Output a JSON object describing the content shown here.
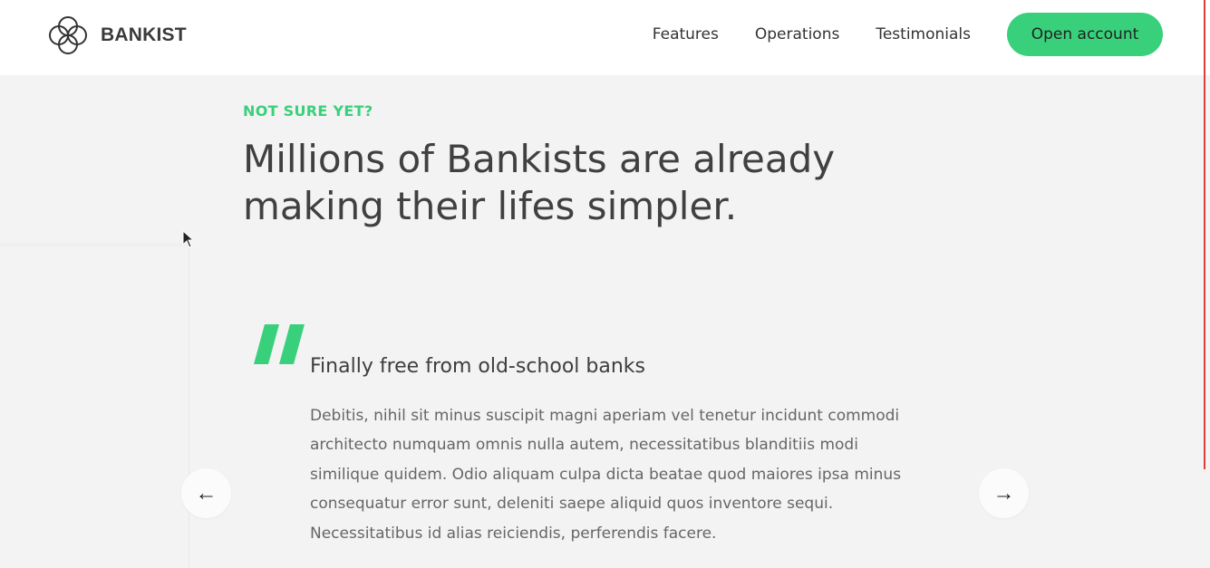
{
  "brand": {
    "name": "BANKIST",
    "logo_icon": "four-overlapping-circles-icon"
  },
  "nav": {
    "links": [
      "Features",
      "Operations",
      "Testimonials"
    ],
    "cta_label": "Open account"
  },
  "section": {
    "subtitle": "NOT SURE YET?",
    "title": "Millions of Bankists are already making their lifes simpler."
  },
  "testimonial": {
    "quote_icon": "quote-mark-icon",
    "heading": "Finally free from old-school banks",
    "body": "Debitis, nihil sit minus suscipit magni aperiam vel tenetur incidunt commodi architecto numquam omnis nulla autem, necessitatibus blanditiis modi similique quidem. Odio aliquam culpa dicta beatae quod maiores ipsa minus consequatur error sunt, deleniti saepe aliquid quos inventore sequi. Necessitatibus id alias reiciendis, perferendis facere."
  },
  "slider": {
    "prev_label": "←",
    "next_label": "→"
  },
  "colors": {
    "accent": "#39d07b",
    "background": "#f3f3f3",
    "nav_background": "#ffffff",
    "heading_text": "#404040",
    "body_text": "#666666"
  }
}
